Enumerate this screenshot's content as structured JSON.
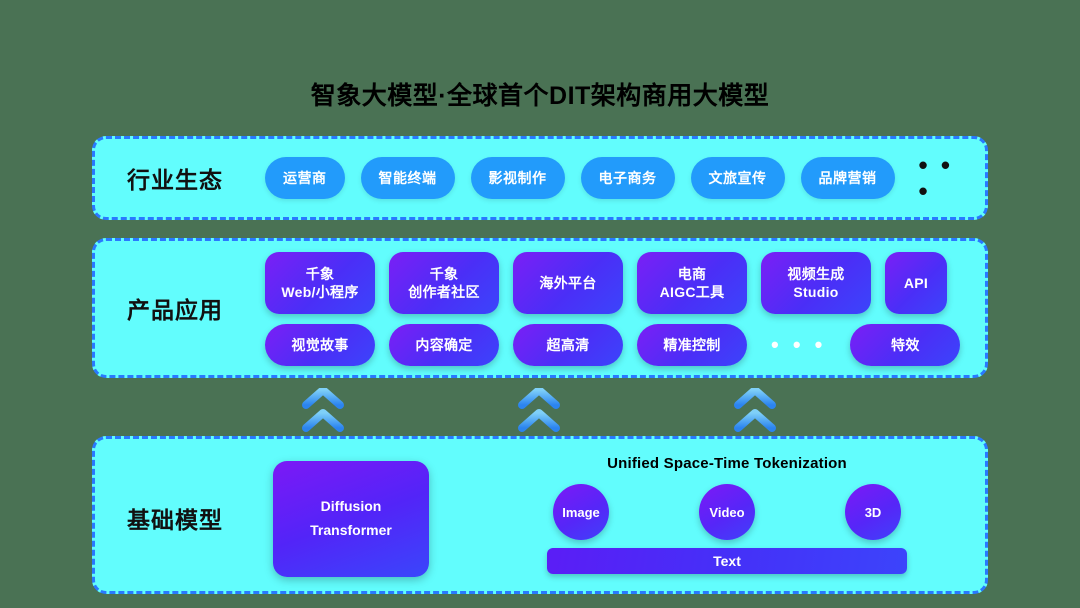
{
  "page": {
    "background_color": "#4a7254",
    "title": "智象大模型·全球首个DIT架构商用大模型"
  },
  "colors": {
    "panel_fill": "#62fdfd",
    "panel_border": "#2979ff",
    "pill_blue": "#229bfb",
    "card_purple_from": "#7b1ff5",
    "card_purple_to": "#3b45fb",
    "arrow_blue": "#3f9bf5",
    "text_dark": "#111111",
    "text_light": "#ffffff"
  },
  "ecosystem": {
    "label": "行业生态",
    "pills": [
      {
        "label": "运营商"
      },
      {
        "label": "智能终端"
      },
      {
        "label": "影视制作"
      },
      {
        "label": "电子商务"
      },
      {
        "label": "文旅宣传"
      },
      {
        "label": "品牌营销"
      }
    ],
    "ellipsis": "• • •"
  },
  "products": {
    "label": "产品应用",
    "row_primary": [
      {
        "label": "千象\nWeb/小程序"
      },
      {
        "label": "千象\n创作者社区"
      },
      {
        "label": "海外平台"
      },
      {
        "label": "电商\nAIGC工具"
      },
      {
        "label": "视频生成\nStudio"
      },
      {
        "label": "API"
      }
    ],
    "row_secondary": [
      {
        "label": "视觉故事"
      },
      {
        "label": "内容确定"
      },
      {
        "label": "超高清"
      },
      {
        "label": "精准控制"
      }
    ],
    "ellipsis": "• • •",
    "row_secondary_tail": [
      {
        "label": "特效"
      }
    ]
  },
  "arrows": {
    "count": 3,
    "direction": "up",
    "style": "double-chevron"
  },
  "base_model": {
    "label": "基础模型",
    "diffusion_box": {
      "line1": "Diffusion",
      "line2": "Transformer"
    },
    "tokenization": {
      "title": "Unified Space-Time Tokenization",
      "modalities": [
        {
          "label": "Image"
        },
        {
          "label": "Video"
        },
        {
          "label": "3D"
        }
      ],
      "base_bar": {
        "label": "Text"
      }
    }
  }
}
